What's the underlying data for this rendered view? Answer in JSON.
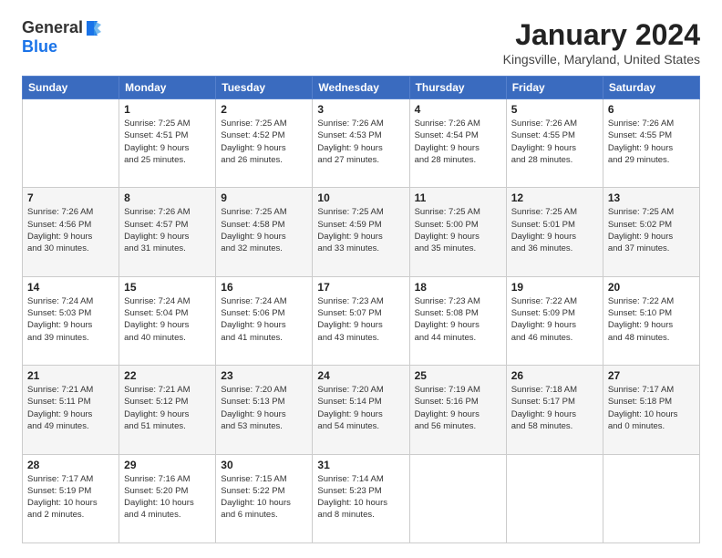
{
  "logo": {
    "text_general": "General",
    "text_blue": "Blue"
  },
  "title": "January 2024",
  "location": "Kingsville, Maryland, United States",
  "headers": [
    "Sunday",
    "Monday",
    "Tuesday",
    "Wednesday",
    "Thursday",
    "Friday",
    "Saturday"
  ],
  "weeks": [
    [
      {
        "num": "",
        "info": ""
      },
      {
        "num": "1",
        "info": "Sunrise: 7:25 AM\nSunset: 4:51 PM\nDaylight: 9 hours\nand 25 minutes."
      },
      {
        "num": "2",
        "info": "Sunrise: 7:25 AM\nSunset: 4:52 PM\nDaylight: 9 hours\nand 26 minutes."
      },
      {
        "num": "3",
        "info": "Sunrise: 7:26 AM\nSunset: 4:53 PM\nDaylight: 9 hours\nand 27 minutes."
      },
      {
        "num": "4",
        "info": "Sunrise: 7:26 AM\nSunset: 4:54 PM\nDaylight: 9 hours\nand 28 minutes."
      },
      {
        "num": "5",
        "info": "Sunrise: 7:26 AM\nSunset: 4:55 PM\nDaylight: 9 hours\nand 28 minutes."
      },
      {
        "num": "6",
        "info": "Sunrise: 7:26 AM\nSunset: 4:55 PM\nDaylight: 9 hours\nand 29 minutes."
      }
    ],
    [
      {
        "num": "7",
        "info": "Sunrise: 7:26 AM\nSunset: 4:56 PM\nDaylight: 9 hours\nand 30 minutes."
      },
      {
        "num": "8",
        "info": "Sunrise: 7:26 AM\nSunset: 4:57 PM\nDaylight: 9 hours\nand 31 minutes."
      },
      {
        "num": "9",
        "info": "Sunrise: 7:25 AM\nSunset: 4:58 PM\nDaylight: 9 hours\nand 32 minutes."
      },
      {
        "num": "10",
        "info": "Sunrise: 7:25 AM\nSunset: 4:59 PM\nDaylight: 9 hours\nand 33 minutes."
      },
      {
        "num": "11",
        "info": "Sunrise: 7:25 AM\nSunset: 5:00 PM\nDaylight: 9 hours\nand 35 minutes."
      },
      {
        "num": "12",
        "info": "Sunrise: 7:25 AM\nSunset: 5:01 PM\nDaylight: 9 hours\nand 36 minutes."
      },
      {
        "num": "13",
        "info": "Sunrise: 7:25 AM\nSunset: 5:02 PM\nDaylight: 9 hours\nand 37 minutes."
      }
    ],
    [
      {
        "num": "14",
        "info": "Sunrise: 7:24 AM\nSunset: 5:03 PM\nDaylight: 9 hours\nand 39 minutes."
      },
      {
        "num": "15",
        "info": "Sunrise: 7:24 AM\nSunset: 5:04 PM\nDaylight: 9 hours\nand 40 minutes."
      },
      {
        "num": "16",
        "info": "Sunrise: 7:24 AM\nSunset: 5:06 PM\nDaylight: 9 hours\nand 41 minutes."
      },
      {
        "num": "17",
        "info": "Sunrise: 7:23 AM\nSunset: 5:07 PM\nDaylight: 9 hours\nand 43 minutes."
      },
      {
        "num": "18",
        "info": "Sunrise: 7:23 AM\nSunset: 5:08 PM\nDaylight: 9 hours\nand 44 minutes."
      },
      {
        "num": "19",
        "info": "Sunrise: 7:22 AM\nSunset: 5:09 PM\nDaylight: 9 hours\nand 46 minutes."
      },
      {
        "num": "20",
        "info": "Sunrise: 7:22 AM\nSunset: 5:10 PM\nDaylight: 9 hours\nand 48 minutes."
      }
    ],
    [
      {
        "num": "21",
        "info": "Sunrise: 7:21 AM\nSunset: 5:11 PM\nDaylight: 9 hours\nand 49 minutes."
      },
      {
        "num": "22",
        "info": "Sunrise: 7:21 AM\nSunset: 5:12 PM\nDaylight: 9 hours\nand 51 minutes."
      },
      {
        "num": "23",
        "info": "Sunrise: 7:20 AM\nSunset: 5:13 PM\nDaylight: 9 hours\nand 53 minutes."
      },
      {
        "num": "24",
        "info": "Sunrise: 7:20 AM\nSunset: 5:14 PM\nDaylight: 9 hours\nand 54 minutes."
      },
      {
        "num": "25",
        "info": "Sunrise: 7:19 AM\nSunset: 5:16 PM\nDaylight: 9 hours\nand 56 minutes."
      },
      {
        "num": "26",
        "info": "Sunrise: 7:18 AM\nSunset: 5:17 PM\nDaylight: 9 hours\nand 58 minutes."
      },
      {
        "num": "27",
        "info": "Sunrise: 7:17 AM\nSunset: 5:18 PM\nDaylight: 10 hours\nand 0 minutes."
      }
    ],
    [
      {
        "num": "28",
        "info": "Sunrise: 7:17 AM\nSunset: 5:19 PM\nDaylight: 10 hours\nand 2 minutes."
      },
      {
        "num": "29",
        "info": "Sunrise: 7:16 AM\nSunset: 5:20 PM\nDaylight: 10 hours\nand 4 minutes."
      },
      {
        "num": "30",
        "info": "Sunrise: 7:15 AM\nSunset: 5:22 PM\nDaylight: 10 hours\nand 6 minutes."
      },
      {
        "num": "31",
        "info": "Sunrise: 7:14 AM\nSunset: 5:23 PM\nDaylight: 10 hours\nand 8 minutes."
      },
      {
        "num": "",
        "info": ""
      },
      {
        "num": "",
        "info": ""
      },
      {
        "num": "",
        "info": ""
      }
    ]
  ]
}
